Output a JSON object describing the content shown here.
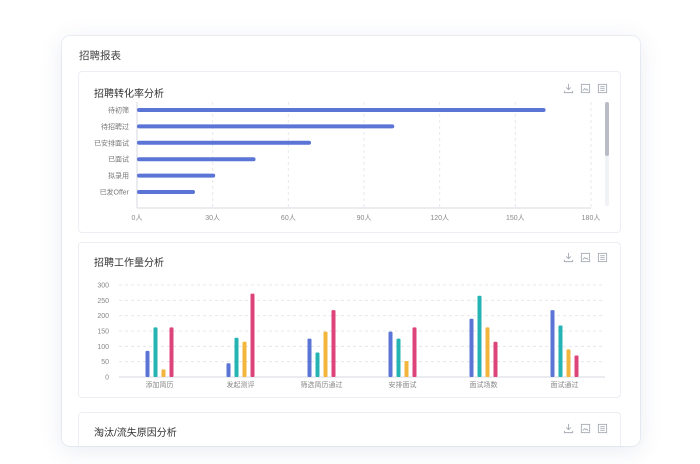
{
  "page": {
    "title": "招聘报表"
  },
  "cards": {
    "conversion": {
      "title": "招聘转化率分析"
    },
    "workload": {
      "title": "招聘工作量分析"
    },
    "loss": {
      "title": "淘汰/流失原因分析"
    }
  },
  "toolbar_icons": [
    "download-icon",
    "image-export-icon",
    "data-view-icon"
  ],
  "colors": {
    "bar_blue": "#5b75d6",
    "teal": "#26b3b3",
    "orange": "#f2b63c",
    "pink": "#dd4479",
    "grid": "#e6e8ee",
    "axis_text": "#888888"
  },
  "chart_data": [
    {
      "type": "bar",
      "orientation": "horizontal",
      "categories": [
        "待初筛",
        "待招聘过",
        "已安排面试",
        "已面试",
        "拟录用",
        "已发Offer"
      ],
      "values": [
        162,
        102,
        69,
        47,
        31,
        23
      ],
      "xlim": [
        0,
        180
      ],
      "x_ticks": [
        "0人",
        "30人",
        "60人",
        "90人",
        "120人",
        "150人",
        "180人"
      ],
      "grid": true
    },
    {
      "type": "bar",
      "categories": [
        "添加简历",
        "发起测评",
        "筛选简历通过",
        "安排面试",
        "面试场数",
        "面试通过"
      ],
      "series": [
        {
          "values": [
            85,
            45,
            125,
            148,
            190,
            218
          ]
        },
        {
          "values": [
            162,
            128,
            80,
            125,
            265,
            168
          ]
        },
        {
          "values": [
            25,
            115,
            148,
            52,
            162,
            90
          ]
        },
        {
          "values": [
            162,
            272,
            218,
            162,
            115,
            70
          ]
        }
      ],
      "ylim": [
        0,
        300
      ],
      "y_ticks": [
        "0",
        "50",
        "100",
        "150",
        "200",
        "250",
        "300"
      ],
      "grid": true
    }
  ]
}
